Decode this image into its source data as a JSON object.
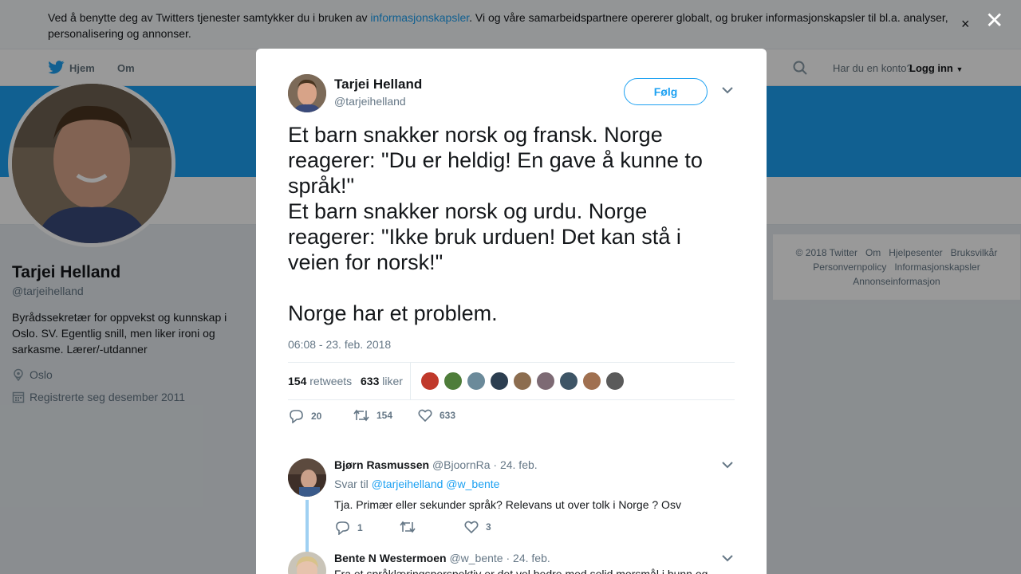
{
  "cookie": {
    "text_before": "Ved å benytte deg av Twitters tjenester samtykker du i bruken av ",
    "link": "informasjonskapsler",
    "text_after": ". Vi og våre samarbeidspartnere opererer globalt, og bruker informasjonskapsler til bl.a. analyser, personalisering og annonser.",
    "close": "×"
  },
  "overlay_close": "✕",
  "nav": {
    "home": "Hjem",
    "about": "Om",
    "account_question": "Har du en konto?",
    "login": "Logg inn"
  },
  "profile": {
    "name": "Tarjei Helland",
    "handle": "@tarjeihelland",
    "bio": "Byrådssekretær for oppvekst og kunnskap i Oslo. SV. Egentlig snill, men liker ironi og sarkasme. Lærer/-utdanner",
    "location": "Oslo",
    "joined": "Registrerte seg desember 2011"
  },
  "footer": {
    "links": [
      "© 2018 Twitter",
      "Om",
      "Hjelpesenter",
      "Bruksvilkår",
      "Personvernpolicy",
      "Informasjonskapsler",
      "Annonseinformasjon"
    ]
  },
  "tweet": {
    "name": "Tarjei Helland",
    "handle": "@tarjeihelland",
    "follow": "Følg",
    "text": "Et barn snakker norsk og fransk. Norge reagerer: \"Du er heldig! En gave å kunne to språk!\"\nEt barn snakker norsk og urdu. Norge reagerer: \"Ikke bruk urduen! Det kan stå i veien for norsk!\"\n\nNorge har et problem.",
    "time": "06:08 - 23. feb. 2018",
    "retweets_count": "154",
    "retweets_label": "retweets",
    "likes_count": "633",
    "likes_label": "liker",
    "reply_count": "20",
    "retweet_count": "154",
    "like_count": "633",
    "liker_colors": [
      "#c0392b",
      "#4e7d3a",
      "#6b8a9a",
      "#2c3e50",
      "#8c6d4f",
      "#7d6a74",
      "#3e5566",
      "#a07050",
      "#5a5a5a"
    ]
  },
  "replies": [
    {
      "name": "Bjørn Rasmussen",
      "handle": "@BjoornRa",
      "date": "· 24. feb.",
      "reply_to_label": "Svar til",
      "mention1": "@tarjeihelland",
      "mention2": "@w_bente",
      "text": "Tja. Primær eller sekunder språk?  Relevans ut over  tolk i Norge ? Osv",
      "reply_count": "1",
      "retweet_count": "",
      "like_count": "3"
    },
    {
      "name": "Bente N Westermoen",
      "handle": "@w_bente",
      "date": "· 24. feb.",
      "text": "Fra et språklæringsperspektiv er det vel bedre med solid morsmål i bunn og"
    }
  ]
}
